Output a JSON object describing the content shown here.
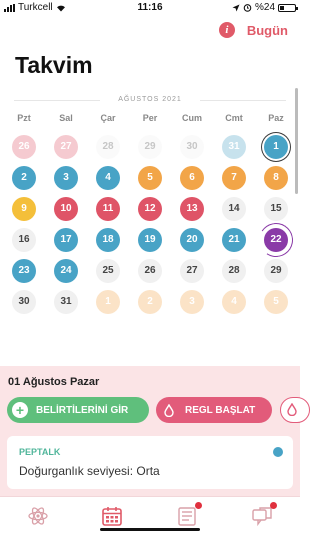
{
  "status_bar": {
    "carrier": "Turkcell",
    "time": "11:16",
    "battery": "%24"
  },
  "header": {
    "today_label": "Bugün",
    "title": "Takvim"
  },
  "calendar": {
    "month_label": "AĞUSTOS 2021",
    "weekdays": [
      "Pzt",
      "Sal",
      "Çar",
      "Per",
      "Cum",
      "Cmt",
      "Paz"
    ],
    "days": [
      {
        "n": "26",
        "c": "red",
        "faded": true
      },
      {
        "n": "27",
        "c": "red",
        "faded": true
      },
      {
        "n": "28",
        "c": "gray",
        "faded": true
      },
      {
        "n": "29",
        "c": "gray",
        "faded": true
      },
      {
        "n": "30",
        "c": "gray",
        "faded": true
      },
      {
        "n": "31",
        "c": "blue",
        "faded": true
      },
      {
        "n": "1",
        "c": "blue",
        "selected": true
      },
      {
        "n": "2",
        "c": "blue"
      },
      {
        "n": "3",
        "c": "blue"
      },
      {
        "n": "4",
        "c": "blue"
      },
      {
        "n": "5",
        "c": "orange"
      },
      {
        "n": "6",
        "c": "orange"
      },
      {
        "n": "7",
        "c": "orange"
      },
      {
        "n": "8",
        "c": "orange"
      },
      {
        "n": "9",
        "c": "yellow"
      },
      {
        "n": "10",
        "c": "red"
      },
      {
        "n": "11",
        "c": "red"
      },
      {
        "n": "12",
        "c": "red"
      },
      {
        "n": "13",
        "c": "red"
      },
      {
        "n": "14",
        "c": "gray"
      },
      {
        "n": "15",
        "c": "gray"
      },
      {
        "n": "16",
        "c": "gray"
      },
      {
        "n": "17",
        "c": "blue"
      },
      {
        "n": "18",
        "c": "blue"
      },
      {
        "n": "19",
        "c": "blue"
      },
      {
        "n": "20",
        "c": "blue"
      },
      {
        "n": "21",
        "c": "blue"
      },
      {
        "n": "22",
        "c": "purple",
        "today": true
      },
      {
        "n": "23",
        "c": "blue"
      },
      {
        "n": "24",
        "c": "blue"
      },
      {
        "n": "25",
        "c": "gray"
      },
      {
        "n": "26",
        "c": "gray"
      },
      {
        "n": "27",
        "c": "gray"
      },
      {
        "n": "28",
        "c": "gray"
      },
      {
        "n": "29",
        "c": "gray"
      },
      {
        "n": "30",
        "c": "gray"
      },
      {
        "n": "31",
        "c": "gray"
      },
      {
        "n": "1",
        "c": "orange",
        "faded": true
      },
      {
        "n": "2",
        "c": "orange",
        "faded": true
      },
      {
        "n": "3",
        "c": "orange",
        "faded": true
      },
      {
        "n": "4",
        "c": "orange",
        "faded": true
      },
      {
        "n": "5",
        "c": "orange",
        "faded": true
      }
    ]
  },
  "day_panel": {
    "date_label": "01 Ağustos Pazar",
    "symptoms_button": "BELİRTİLERİNİ GİR",
    "period_button": "REGL BAŞLAT",
    "card": {
      "tag": "PEPTALK",
      "text": "Doğurganlık seviyesi: Orta"
    }
  },
  "tabbar": {
    "tabs": [
      {
        "icon": "atom-icon",
        "active": false,
        "badge": false
      },
      {
        "icon": "calendar-icon",
        "active": true,
        "badge": false
      },
      {
        "icon": "news-icon",
        "active": false,
        "badge": true
      },
      {
        "icon": "chat-icon",
        "active": false,
        "badge": true
      }
    ]
  },
  "colors": {
    "accent": "#e05a68",
    "blue": "#48a3c6",
    "orange": "#f2a548",
    "yellow": "#f4bf3a",
    "red": "#df5467",
    "purple": "#8a3aa7",
    "green": "#5fbf7c",
    "panel": "#fbe4e6"
  }
}
